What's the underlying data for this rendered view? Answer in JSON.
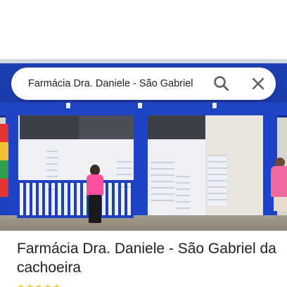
{
  "search": {
    "query": "Farmácia Dra. Daniele - São Gabriel"
  },
  "icons": {
    "search": "search-icon",
    "close": "close-icon",
    "star": "star-icon"
  },
  "place": {
    "title": "Farmácia Dra. Daniele - São Gabriel da cachoeira",
    "rating_stars": "★★★★★"
  },
  "colors": {
    "facade_blue": "#1d3fb3",
    "accent_pink": "#ff4fa0",
    "star_yellow": "#f4b400",
    "text_primary": "#202124",
    "icon_gray": "#5f6368"
  }
}
